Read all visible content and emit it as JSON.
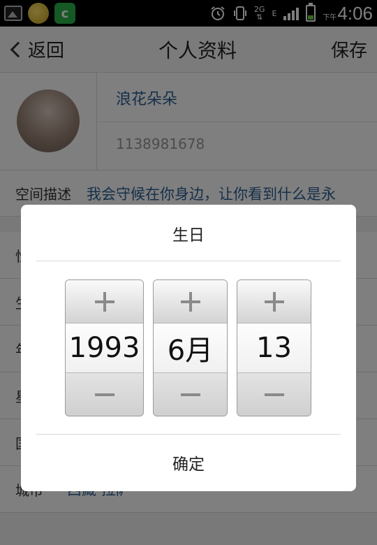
{
  "status_bar": {
    "network": "2G",
    "network_letter": "E",
    "clock_prefix": "下午",
    "time": "4:06"
  },
  "header": {
    "back_label": "返回",
    "title": "个人资料",
    "save_label": "保存"
  },
  "profile": {
    "nickname": "浪花朵朵",
    "qq_number": "1138981678"
  },
  "description": {
    "label": "空间描述",
    "value": "我会守候在你身边，让你看到什么是永"
  },
  "list_partial": [
    {
      "label": "性",
      "value": ""
    },
    {
      "label": "生",
      "value": ""
    },
    {
      "label": "年",
      "value": ""
    },
    {
      "label": "星",
      "value": ""
    },
    {
      "label": "国",
      "value": ""
    },
    {
      "label": "城市",
      "value": "西藏 拉萨"
    }
  ],
  "dialog": {
    "title": "生日",
    "year": "1993",
    "month": "6月",
    "day": "13",
    "confirm_label": "确定"
  }
}
